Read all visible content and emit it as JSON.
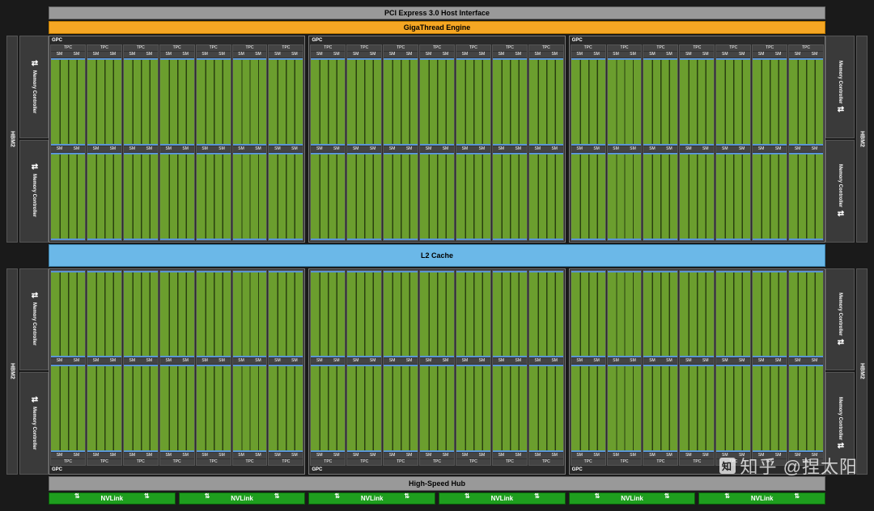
{
  "pci_label": "PCI Express 3.0 Host Interface",
  "gt_label": "GigaThread Engine",
  "l2_label": "L2 Cache",
  "hub_label": "High-Speed Hub",
  "hbm_label": "HBM2",
  "mc_label": "Memory Controller",
  "gpc_label": "GPC",
  "tpc_label": "TPC",
  "sm_label": "SM",
  "nvlink_label": "NVLink",
  "counts": {
    "gpcs": 6,
    "tpcs_per_gpc": 7,
    "sms_per_tpc": 2,
    "nvlinks": 6,
    "hbm2_stacks": 4,
    "memory_controllers": 8
  },
  "watermark": "知乎 @捏太阳",
  "watermark_logo": "知"
}
